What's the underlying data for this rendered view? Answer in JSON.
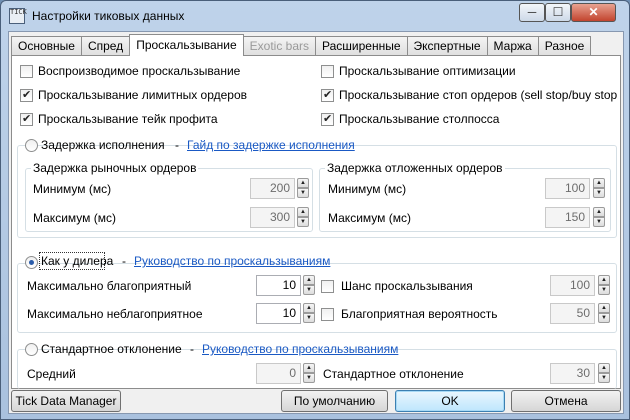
{
  "window": {
    "title": "Настройки тиковых данных",
    "icon_text": "TICK",
    "minimize": "─",
    "maximize": "☐",
    "close": "✕"
  },
  "tabs": [
    "Основные",
    "Спред",
    "Проскальзывание",
    "Exotic bars",
    "Расширенные",
    "Экспертные",
    "Маржа",
    "Разное"
  ],
  "checks": {
    "reproducible": {
      "label": "Воспроизводимое проскальзывание",
      "checked": false
    },
    "optimization": {
      "label": "Проскальзывание оптимизации",
      "checked": false
    },
    "limit_orders": {
      "label": "Проскальзывание лимитных ордеров",
      "checked": true
    },
    "stop_orders": {
      "label": "Проскальзывание стоп ордеров (sell stop/buy stop",
      "checked": true
    },
    "take_profit": {
      "label": "Проскальзывание тейк профита",
      "checked": true
    },
    "stop_loss": {
      "label": "Проскальзывание столпосса",
      "checked": true
    }
  },
  "exec_delay": {
    "label": "Задержка исполнения",
    "dash": "-",
    "link": "Гайд по задержке исполнения",
    "market": {
      "title": "Задержка рыночных ордеров",
      "min_label": "Минимум (мс)",
      "min": "200",
      "max_label": "Максимум (мс)",
      "max": "300"
    },
    "pending": {
      "title": "Задержка отложенных ордеров",
      "min_label": "Минимум (мс)",
      "min": "100",
      "max_label": "Максимум (мс)",
      "max": "150"
    }
  },
  "dealer": {
    "label": "Как у дилера",
    "dash": "-",
    "link": "Руководство по проскальзываниям",
    "max_fav_label": "Максимально благоприятный",
    "max_fav": "10",
    "max_unfav_label": "Максимально неблагоприятное",
    "max_unfav": "10",
    "chance_label": "Шанс проскальзывания",
    "chance": "100",
    "fav_prob_label": "Благоприятная вероятность",
    "fav_prob": "50"
  },
  "stddev": {
    "label": "Стандартное отклонение",
    "dash": "-",
    "link": "Руководство по проскальзываниям",
    "mean_label": "Средний",
    "mean": "0",
    "dev_label": "Стандартное отклонение",
    "dev": "30"
  },
  "buttons": {
    "tick_manager": "Tick Data Manager",
    "defaults": "По умолчанию",
    "ok": "OK",
    "cancel": "Отмена"
  }
}
